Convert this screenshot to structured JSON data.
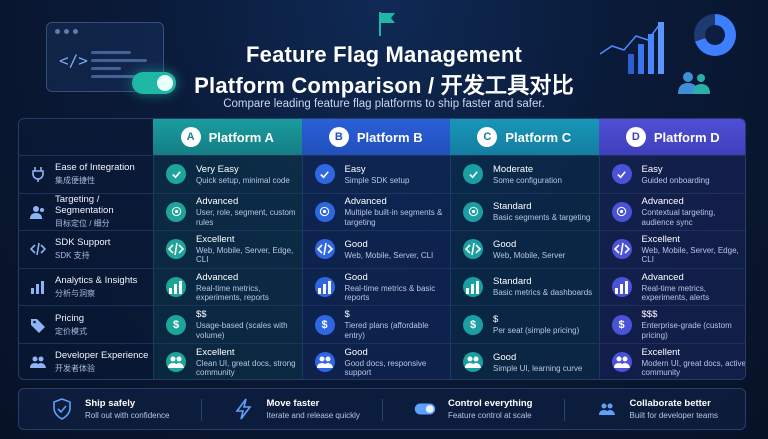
{
  "header": {
    "title_line1": "Feature Flag Management",
    "title_line2": "Platform Comparison / 开发工具对比",
    "subtitle": "Compare leading feature flag platforms to ship faster and safer."
  },
  "platforms": [
    {
      "label": "Platform A",
      "badge": "A",
      "color": "#1a9c9e"
    },
    {
      "label": "Platform B",
      "badge": "B",
      "color": "#2a5fd8"
    },
    {
      "label": "Platform C",
      "badge": "C",
      "color": "#1896b8"
    },
    {
      "label": "Platform D",
      "badge": "D",
      "color": "#4f4fd6"
    }
  ],
  "rows": [
    {
      "label": "Ease of Integration",
      "label_zh": "集成便捷性",
      "icon": "plug-icon",
      "cells": [
        {
          "level": "Very Easy",
          "desc": "Quick setup, minimal code",
          "icon": "check-icon"
        },
        {
          "level": "Easy",
          "desc": "Simple SDK setup",
          "icon": "check-icon"
        },
        {
          "level": "Moderate",
          "desc": "Some configuration",
          "icon": "check-icon"
        },
        {
          "level": "Easy",
          "desc": "Guided onboarding",
          "icon": "check-icon"
        }
      ]
    },
    {
      "label": "Targeting / Segmentation",
      "label_zh": "目标定位 / 细分",
      "icon": "users-icon",
      "cells": [
        {
          "level": "Advanced",
          "desc": "User, role, segment, custom rules",
          "icon": "target-icon"
        },
        {
          "level": "Advanced",
          "desc": "Multiple built-in segments & targeting",
          "icon": "target-icon"
        },
        {
          "level": "Standard",
          "desc": "Basic segments & targeting",
          "icon": "target-icon"
        },
        {
          "level": "Advanced",
          "desc": "Contextual targeting, audience sync",
          "icon": "target-icon"
        }
      ]
    },
    {
      "label": "SDK Support",
      "label_zh": "SDK 支持",
      "icon": "code-icon",
      "cells": [
        {
          "level": "Excellent",
          "desc": "Web, Mobile, Server, Edge, CLI",
          "icon": "code-icon"
        },
        {
          "level": "Good",
          "desc": "Web, Mobile, Server, CLI",
          "icon": "code-icon"
        },
        {
          "level": "Good",
          "desc": "Web, Mobile, Server",
          "icon": "code-icon"
        },
        {
          "level": "Excellent",
          "desc": "Web, Mobile, Server, Edge, CLI",
          "icon": "code-icon"
        }
      ]
    },
    {
      "label": "Analytics & Insights",
      "label_zh": "分析与洞察",
      "icon": "bar-chart-icon",
      "cells": [
        {
          "level": "Advanced",
          "desc": "Real-time metrics, experiments, reports",
          "icon": "bar-chart-icon"
        },
        {
          "level": "Good",
          "desc": "Real-time metrics & basic reports",
          "icon": "bar-chart-icon"
        },
        {
          "level": "Standard",
          "desc": "Basic metrics & dashboards",
          "icon": "bar-chart-icon"
        },
        {
          "level": "Advanced",
          "desc": "Real-time metrics, experiments, alerts",
          "icon": "bar-chart-icon"
        }
      ]
    },
    {
      "label": "Pricing",
      "label_zh": "定价模式",
      "icon": "tag-icon",
      "cells": [
        {
          "level": "$$",
          "desc": "Usage-based (scales with volume)",
          "icon": "dollar-icon"
        },
        {
          "level": "$",
          "desc": "Tiered plans (affordable entry)",
          "icon": "dollar-icon"
        },
        {
          "level": "$",
          "desc": "Per seat (simple pricing)",
          "icon": "dollar-icon"
        },
        {
          "level": "$$$",
          "desc": "Enterprise-grade (custom pricing)",
          "icon": "dollar-icon"
        }
      ]
    },
    {
      "label": "Developer Experience",
      "label_zh": "开发者体验",
      "icon": "team-icon",
      "cells": [
        {
          "level": "Excellent",
          "desc": "Clean UI, great docs, strong community",
          "icon": "team-icon"
        },
        {
          "level": "Good",
          "desc": "Good docs, responsive support",
          "icon": "team-icon"
        },
        {
          "level": "Good",
          "desc": "Simple UI, learning curve",
          "icon": "team-icon"
        },
        {
          "level": "Excellent",
          "desc": "Modern UI, great docs, active community",
          "icon": "team-icon"
        }
      ]
    }
  ],
  "footer": [
    {
      "title": "Ship safely",
      "desc": "Roll out with confidence",
      "icon": "shield-check-icon"
    },
    {
      "title": "Move faster",
      "desc": "Iterate and release quickly",
      "icon": "lightning-icon"
    },
    {
      "title": "Control everything",
      "desc": "Feature control at scale",
      "icon": "toggle-icon"
    },
    {
      "title": "Collaborate better",
      "desc": "Built for developer teams",
      "icon": "team-icon"
    }
  ]
}
